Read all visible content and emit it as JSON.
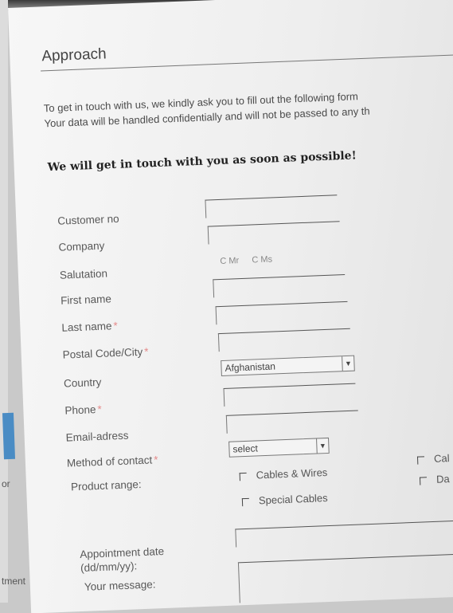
{
  "form": {
    "heading": "Approach",
    "intro_line1": "To get in touch with us, we kindly ask you to fill out the following form",
    "intro_line2": "Your data will be handled confidentially and will not be passed to any th",
    "bold_note": "We will get in touch with you as soon as possible!",
    "labels": {
      "customer_no": "Customer no",
      "company": "Company",
      "salutation": "Salutation",
      "first_name": "First name",
      "last_name": "Last name",
      "postal_city": "Postal Code/City",
      "country": "Country",
      "phone": "Phone",
      "email": "Email-adress",
      "method": "Method of contact",
      "product_range": "Product range:",
      "appointment_1": "Appointment date",
      "appointment_2": "(dd/mm/yy):",
      "message": "Your message:"
    },
    "required_mark": "*",
    "salutation_options": [
      "Mr",
      "Ms"
    ],
    "country_value": "Afghanistan",
    "method_value": "select",
    "product_options": [
      "Cables & Wires",
      "Special Cables"
    ],
    "product_options_right": [
      "Cal",
      "Da"
    ],
    "left_edge_text": [
      "or",
      "tment"
    ]
  },
  "icons": {
    "dropdown": "dropdown-arrow-icon",
    "radio": "radio-icon",
    "checkbox": "checkbox-icon"
  }
}
